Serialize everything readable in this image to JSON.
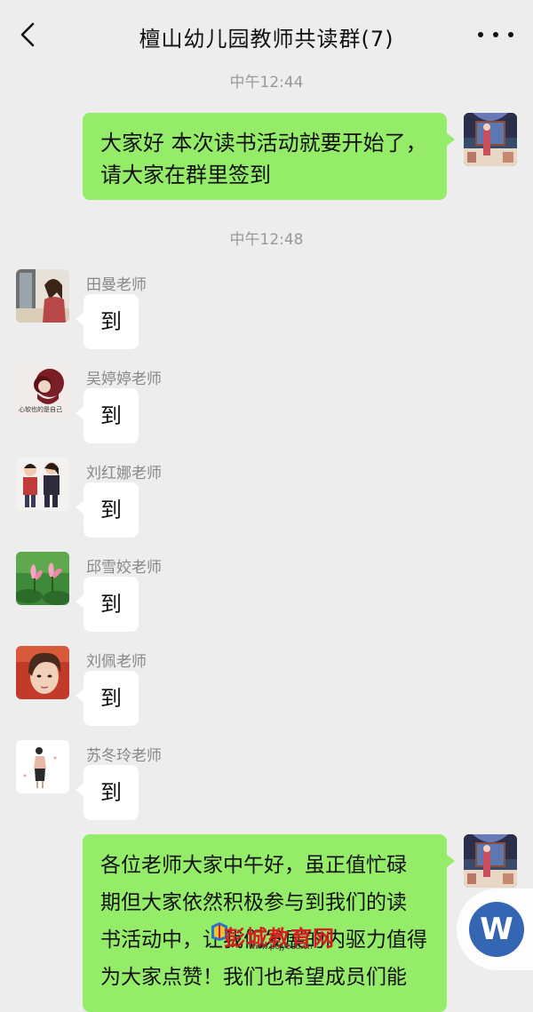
{
  "header": {
    "title": "檀山幼儿园教师共读群(7)"
  },
  "timestamps": [
    "中午12:44",
    "中午12:48"
  ],
  "messages": {
    "m1": {
      "sender": "me",
      "text_line1": "大家好 本次读书活动就要开始了，",
      "text_line2": "请大家在群里签到"
    },
    "r1": {
      "sender": "田曼老师",
      "text": "到"
    },
    "r2": {
      "sender": "吴婷婷老师",
      "text": "到"
    },
    "r3": {
      "sender": "刘红娜老师",
      "text": "到"
    },
    "r4": {
      "sender": "邱雪姣老师",
      "text": "到"
    },
    "r5": {
      "sender": "刘佩老师",
      "text": "到"
    },
    "r6": {
      "sender": "苏冬玲老师",
      "text": "到"
    },
    "m2": {
      "sender": "me",
      "lines": [
        "各位老师大家中午好，虽正值忙碌",
        "期但大家依然积极参与到我们的读",
        "书活动中，让我们发展的内驱力值得",
        "为大家点赞！我们也希望成员们能"
      ]
    }
  },
  "avatar2_text": "心软也的是自己",
  "fab": {
    "label": "W"
  },
  "watermark": {
    "text": "彭城教育网",
    "url": "www.pcjyedu.cn"
  },
  "colors": {
    "background": "#ededed",
    "my_bubble": "#95ec69",
    "other_bubble": "#ffffff",
    "fab": "#3466b4",
    "watermark": "#d42020"
  }
}
